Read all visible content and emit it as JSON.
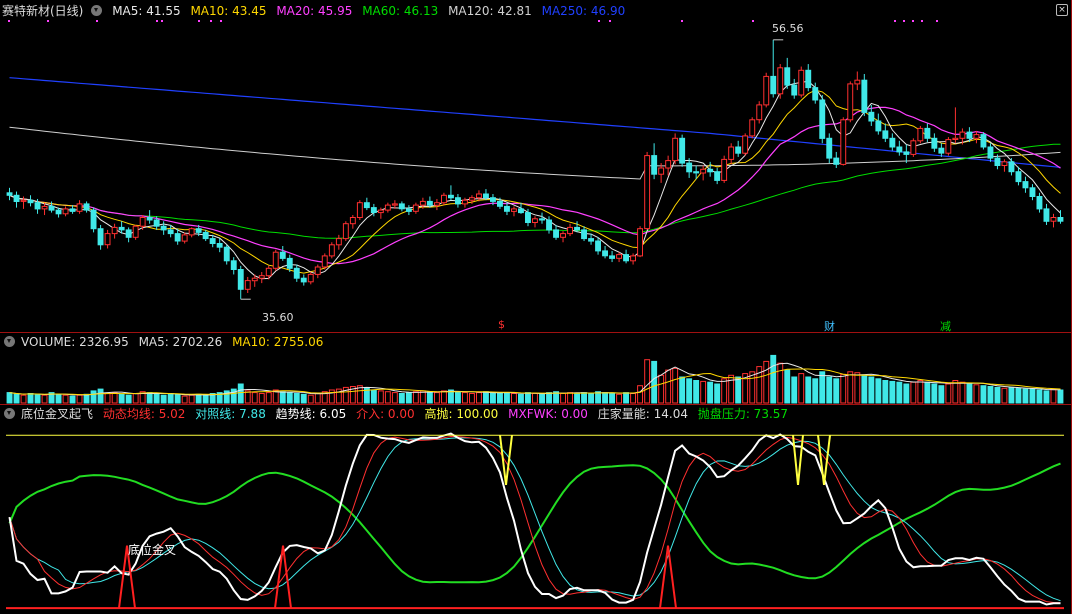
{
  "header": {
    "stock_title": "赛特新材(日线)",
    "ma5": "MA5: 41.55",
    "ma10": "MA10: 43.45",
    "ma20": "MA20: 45.95",
    "ma60": "MA60: 46.13",
    "ma120": "MA120: 42.81",
    "ma250": "MA250: 46.90"
  },
  "volume_header": {
    "title": "VOLUME: 2326.95",
    "ma5": "MA5: 2702.26",
    "ma10": "MA10: 2755.06"
  },
  "indicator_header": {
    "title": "底位金叉起飞",
    "dtjx": "动态均线: 5.02",
    "dzx": "对照线: 7.88",
    "qsx": "趋势线: 6.05",
    "jr": "介入: 0.00",
    "gp": "高抛: 100.00",
    "mxfwk": "MXFWK: 0.00",
    "zjln": "庄家量能: 14.04",
    "ppyl": "抛盘压力: 73.57"
  },
  "annotations": {
    "high_label": "56.56",
    "low_label": "35.60",
    "mark_s": "$",
    "mark_cai": "财",
    "mark_jian": "减",
    "cross_label": "底位金叉"
  },
  "colors": {
    "ma5": "#e8e8e8",
    "ma10": "#ffd700",
    "ma20": "#ff40ff",
    "ma60": "#00dd00",
    "ma120": "#d0d0d0",
    "ma250": "#2040ff",
    "up": "#ff3030",
    "down": "#40e8e8"
  },
  "chart_data": [
    {
      "type": "candlestick",
      "title": "赛特新材(日线)",
      "ylim": [
        34,
        58
      ],
      "annotated_high": 56.56,
      "annotated_low": 35.6,
      "candles": [
        [
          44.2,
          44.6,
          43.6,
          44.0
        ],
        [
          44.0,
          44.3,
          43.0,
          43.5
        ],
        [
          43.5,
          43.9,
          42.9,
          43.6
        ],
        [
          43.6,
          44.0,
          43.1,
          43.4
        ],
        [
          43.4,
          43.7,
          42.5,
          42.9
        ],
        [
          42.9,
          43.4,
          42.4,
          43.1
        ],
        [
          43.1,
          43.5,
          42.6,
          42.8
        ],
        [
          42.8,
          43.0,
          42.2,
          42.5
        ],
        [
          42.5,
          43.1,
          42.3,
          42.9
        ],
        [
          42.9,
          43.2,
          42.5,
          42.7
        ],
        [
          42.7,
          43.6,
          42.5,
          43.3
        ],
        [
          43.3,
          43.5,
          42.6,
          42.8
        ],
        [
          42.8,
          43.0,
          41.0,
          41.3
        ],
        [
          41.3,
          41.6,
          39.6,
          40.0
        ],
        [
          40.0,
          41.2,
          39.7,
          40.9
        ],
        [
          40.9,
          41.7,
          40.5,
          41.4
        ],
        [
          41.4,
          41.9,
          40.9,
          41.2
        ],
        [
          41.2,
          41.4,
          40.2,
          40.6
        ],
        [
          40.6,
          41.6,
          40.4,
          41.5
        ],
        [
          41.5,
          42.4,
          41.2,
          42.2
        ],
        [
          42.2,
          42.8,
          41.7,
          42.0
        ],
        [
          42.0,
          42.3,
          41.2,
          41.5
        ],
        [
          41.5,
          41.9,
          40.8,
          41.2
        ],
        [
          41.2,
          41.6,
          40.6,
          40.9
        ],
        [
          40.9,
          41.3,
          40.0,
          40.3
        ],
        [
          40.3,
          41.0,
          40.1,
          40.8
        ],
        [
          40.8,
          41.4,
          40.6,
          41.3
        ],
        [
          41.3,
          41.6,
          40.7,
          41.0
        ],
        [
          41.0,
          41.2,
          40.3,
          40.5
        ],
        [
          40.5,
          40.8,
          39.8,
          40.1
        ],
        [
          40.1,
          40.5,
          39.4,
          39.8
        ],
        [
          39.8,
          40.0,
          38.4,
          38.7
        ],
        [
          38.7,
          39.0,
          37.6,
          38.0
        ],
        [
          38.0,
          38.3,
          35.6,
          36.4
        ],
        [
          36.4,
          37.4,
          36.1,
          37.1
        ],
        [
          37.1,
          37.6,
          36.6,
          37.3
        ],
        [
          37.3,
          37.8,
          36.9,
          37.5
        ],
        [
          37.5,
          38.3,
          37.2,
          38.1
        ],
        [
          38.1,
          39.6,
          37.9,
          39.4
        ],
        [
          39.4,
          39.9,
          38.7,
          38.9
        ],
        [
          38.9,
          39.2,
          37.8,
          38.1
        ],
        [
          38.1,
          38.4,
          37.0,
          37.3
        ],
        [
          37.3,
          37.6,
          36.7,
          37.0
        ],
        [
          37.0,
          37.8,
          36.8,
          37.6
        ],
        [
          37.6,
          38.4,
          37.3,
          38.2
        ],
        [
          38.2,
          39.3,
          38.0,
          39.1
        ],
        [
          39.1,
          40.2,
          38.9,
          40.0
        ],
        [
          40.0,
          40.8,
          39.6,
          40.5
        ],
        [
          40.5,
          41.9,
          40.3,
          41.7
        ],
        [
          41.7,
          42.4,
          41.3,
          42.2
        ],
        [
          42.2,
          43.6,
          42.0,
          43.4
        ],
        [
          43.4,
          43.8,
          42.8,
          43.0
        ],
        [
          43.0,
          43.3,
          42.3,
          42.6
        ],
        [
          42.6,
          43.0,
          42.1,
          42.8
        ],
        [
          42.8,
          43.4,
          42.6,
          43.2
        ],
        [
          43.2,
          43.6,
          42.9,
          43.3
        ],
        [
          43.3,
          43.5,
          42.7,
          42.9
        ],
        [
          42.9,
          43.2,
          42.4,
          42.7
        ],
        [
          42.7,
          43.4,
          42.5,
          43.2
        ],
        [
          43.2,
          43.8,
          42.9,
          43.5
        ],
        [
          43.5,
          43.9,
          43.0,
          43.2
        ],
        [
          43.2,
          43.7,
          42.8,
          43.4
        ],
        [
          43.4,
          44.2,
          43.2,
          44.0
        ],
        [
          44.0,
          44.8,
          43.6,
          43.8
        ],
        [
          43.8,
          44.1,
          43.0,
          43.3
        ],
        [
          43.3,
          43.8,
          43.0,
          43.6
        ],
        [
          43.6,
          44.0,
          43.3,
          43.8
        ],
        [
          43.8,
          44.4,
          43.5,
          44.1
        ],
        [
          44.1,
          44.5,
          43.6,
          43.8
        ],
        [
          43.8,
          44.1,
          43.2,
          43.5
        ],
        [
          43.5,
          43.8,
          42.9,
          43.1
        ],
        [
          43.1,
          43.4,
          42.4,
          42.7
        ],
        [
          42.7,
          43.1,
          42.3,
          42.9
        ],
        [
          42.9,
          43.4,
          42.5,
          42.6
        ],
        [
          42.6,
          42.9,
          41.5,
          41.8
        ],
        [
          41.8,
          42.3,
          41.4,
          42.1
        ],
        [
          42.1,
          42.6,
          41.7,
          42.0
        ],
        [
          42.0,
          42.3,
          40.9,
          41.2
        ],
        [
          41.2,
          41.6,
          40.4,
          40.6
        ],
        [
          40.6,
          41.1,
          40.2,
          40.9
        ],
        [
          40.9,
          41.7,
          40.7,
          41.4
        ],
        [
          41.4,
          41.9,
          41.0,
          41.2
        ],
        [
          41.2,
          41.5,
          40.3,
          40.5
        ],
        [
          40.5,
          40.9,
          40.0,
          40.3
        ],
        [
          40.3,
          40.6,
          39.2,
          39.5
        ],
        [
          39.5,
          39.9,
          38.9,
          39.1
        ],
        [
          39.1,
          39.5,
          38.6,
          38.9
        ],
        [
          38.9,
          39.4,
          38.6,
          39.2
        ],
        [
          39.2,
          39.6,
          38.5,
          38.7
        ],
        [
          38.7,
          39.3,
          38.4,
          39.1
        ],
        [
          39.1,
          41.5,
          39.0,
          41.3
        ],
        [
          41.3,
          47.5,
          41.2,
          47.2
        ],
        [
          47.2,
          48.2,
          45.3,
          45.7
        ],
        [
          45.7,
          46.6,
          45.0,
          46.2
        ],
        [
          46.2,
          47.2,
          45.6,
          46.8
        ],
        [
          46.8,
          49.0,
          46.5,
          48.6
        ],
        [
          48.6,
          48.9,
          46.3,
          46.6
        ],
        [
          46.6,
          47.0,
          45.4,
          45.9
        ],
        [
          45.9,
          46.4,
          45.3,
          45.8
        ],
        [
          45.8,
          46.4,
          45.2,
          46.1
        ],
        [
          46.1,
          46.7,
          45.5,
          45.9
        ],
        [
          45.9,
          46.2,
          44.9,
          45.2
        ],
        [
          45.2,
          47.2,
          45.0,
          46.9
        ],
        [
          46.9,
          48.2,
          46.5,
          47.9
        ],
        [
          47.9,
          48.4,
          47.1,
          47.4
        ],
        [
          47.4,
          49.0,
          47.2,
          48.8
        ],
        [
          48.8,
          50.3,
          48.6,
          50.1
        ],
        [
          50.1,
          51.6,
          49.8,
          51.3
        ],
        [
          51.3,
          53.9,
          51.1,
          53.6
        ],
        [
          53.6,
          56.56,
          51.9,
          52.2
        ],
        [
          52.2,
          54.6,
          51.8,
          54.3
        ],
        [
          54.3,
          55.1,
          52.6,
          52.9
        ],
        [
          52.9,
          53.4,
          51.8,
          52.1
        ],
        [
          52.1,
          54.4,
          51.9,
          54.1
        ],
        [
          54.1,
          54.6,
          52.4,
          52.7
        ],
        [
          52.7,
          53.1,
          51.4,
          51.7
        ],
        [
          51.7,
          52.1,
          48.2,
          48.6
        ],
        [
          48.6,
          49.0,
          46.6,
          47.0
        ],
        [
          47.0,
          47.5,
          46.2,
          46.5
        ],
        [
          46.5,
          50.3,
          46.4,
          50.1
        ],
        [
          50.1,
          53.2,
          49.9,
          53.0
        ],
        [
          53.0,
          54.0,
          52.5,
          53.3
        ],
        [
          53.3,
          53.8,
          50.4,
          50.7
        ],
        [
          50.7,
          51.3,
          49.6,
          50.0
        ],
        [
          50.0,
          50.6,
          48.9,
          49.2
        ],
        [
          49.2,
          49.8,
          48.3,
          48.6
        ],
        [
          48.6,
          49.0,
          47.6,
          47.9
        ],
        [
          47.9,
          48.4,
          47.2,
          47.5
        ],
        [
          47.5,
          48.1,
          46.6,
          47.3
        ],
        [
          47.3,
          48.6,
          47.1,
          48.4
        ],
        [
          48.4,
          49.6,
          48.2,
          49.4
        ],
        [
          49.4,
          49.8,
          48.3,
          48.6
        ],
        [
          48.6,
          49.0,
          47.5,
          47.8
        ],
        [
          47.8,
          48.2,
          47.1,
          47.4
        ],
        [
          47.4,
          48.7,
          47.2,
          48.5
        ],
        [
          48.5,
          51.1,
          48.2,
          48.6
        ],
        [
          48.6,
          49.4,
          48.1,
          49.1
        ],
        [
          49.1,
          49.5,
          48.3,
          48.6
        ],
        [
          48.6,
          49.2,
          48.2,
          48.9
        ],
        [
          48.9,
          49.1,
          47.7,
          47.9
        ],
        [
          47.9,
          48.2,
          46.7,
          47.0
        ],
        [
          47.0,
          47.3,
          46.1,
          46.4
        ],
        [
          46.4,
          46.9,
          45.9,
          46.7
        ],
        [
          46.7,
          47.0,
          45.6,
          45.9
        ],
        [
          45.9,
          46.3,
          44.8,
          45.1
        ],
        [
          45.1,
          45.5,
          44.2,
          44.6
        ],
        [
          44.6,
          44.9,
          43.6,
          43.9
        ],
        [
          43.9,
          44.2,
          42.6,
          42.9
        ],
        [
          42.9,
          43.3,
          41.6,
          41.9
        ],
        [
          41.9,
          42.5,
          41.4,
          42.2
        ],
        [
          42.2,
          42.8,
          41.7,
          41.9
        ]
      ],
      "signal_marks": [
        "$",
        "财",
        "减"
      ]
    },
    {
      "type": "bar",
      "title": "VOLUME",
      "ylabel": "",
      "volumes": [
        12,
        10,
        9,
        11,
        10,
        9,
        12,
        10,
        9,
        8,
        9,
        10,
        14,
        16,
        11,
        12,
        10,
        9,
        11,
        13,
        12,
        10,
        9,
        11,
        10,
        8,
        9,
        10,
        9,
        11,
        12,
        14,
        16,
        22,
        14,
        12,
        11,
        12,
        15,
        13,
        12,
        11,
        10,
        9,
        11,
        13,
        15,
        16,
        18,
        19,
        20,
        17,
        15,
        14,
        13,
        12,
        11,
        12,
        13,
        14,
        13,
        12,
        14,
        15,
        13,
        12,
        11,
        12,
        13,
        12,
        11,
        12,
        11,
        10,
        12,
        11,
        10,
        12,
        13,
        11,
        12,
        11,
        12,
        11,
        13,
        12,
        11,
        10,
        12,
        11,
        20,
        50,
        48,
        32,
        38,
        40,
        30,
        28,
        26,
        25,
        24,
        22,
        28,
        32,
        30,
        34,
        36,
        42,
        48,
        55,
        46,
        38,
        30,
        34,
        30,
        28,
        36,
        30,
        28,
        33,
        36,
        35,
        32,
        30,
        28,
        26,
        25,
        24,
        22,
        24,
        26,
        24,
        22,
        20,
        22,
        26,
        24,
        22,
        21,
        20,
        19,
        18,
        17,
        18,
        17,
        16,
        16,
        15,
        14,
        16,
        15
      ]
    },
    {
      "type": "line",
      "title": "底位金叉起飞",
      "ylim": [
        0,
        100
      ],
      "cross_label": "底位金叉"
    }
  ]
}
